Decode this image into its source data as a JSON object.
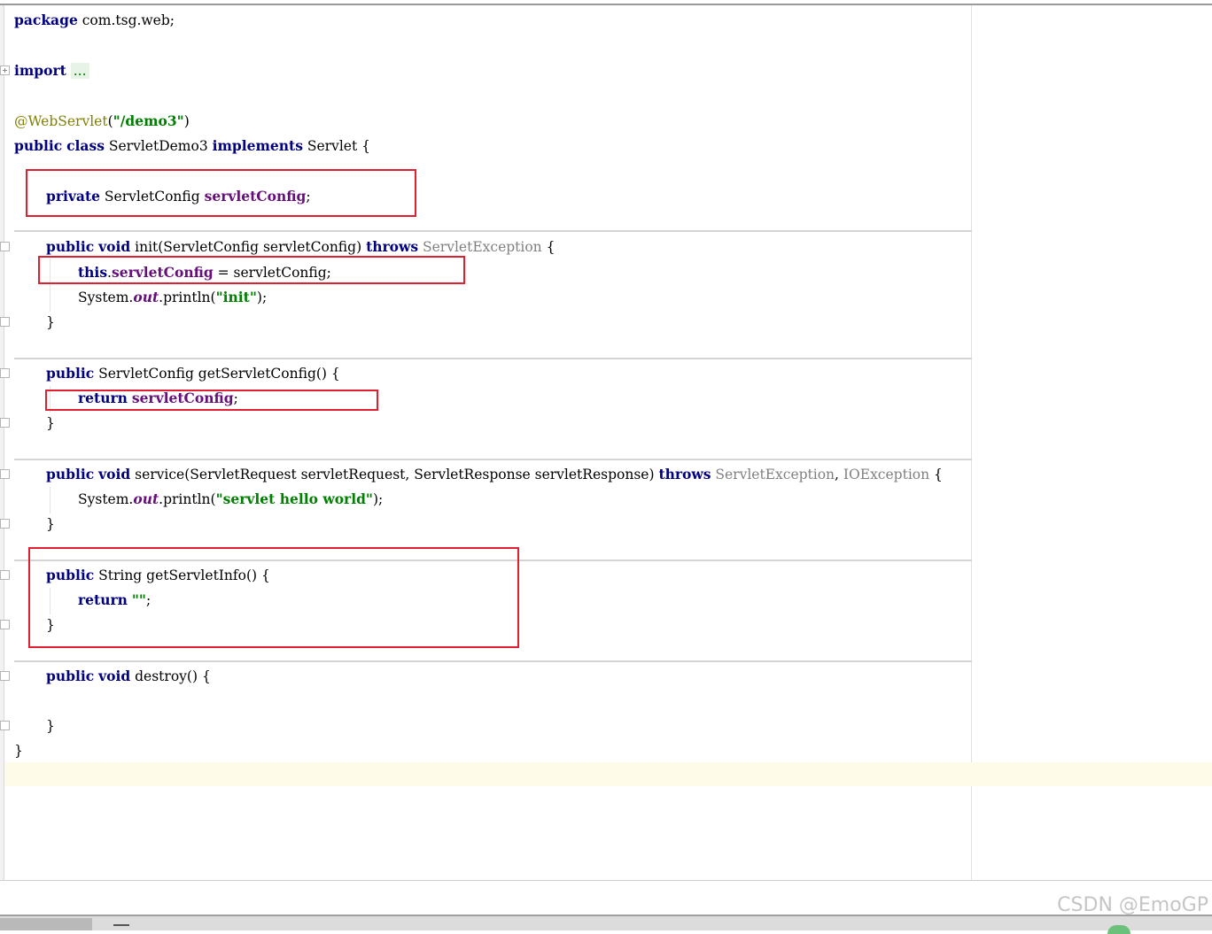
{
  "code": {
    "package_kw": "package",
    "package_name": "com.tsg.web;",
    "import_kw": "import",
    "import_folded": "...",
    "annotation": "@WebServlet",
    "annotation_open": "(",
    "annotation_value": "\"/demo3\"",
    "annotation_close": ")",
    "class_public": "public",
    "class_kw": "class",
    "class_name": "ServletDemo3",
    "implements_kw": "implements",
    "interface_name": "Servlet",
    "open_brace": "{",
    "close_brace": "}",
    "field_private": "private",
    "field_type": "ServletConfig",
    "field_name": "servletConfig",
    "semicolon": ";",
    "init_public": "public",
    "init_void": "void",
    "init_sig": "init(ServletConfig servletConfig)",
    "init_throws": "throws",
    "init_exception": "ServletException",
    "this_kw": "this",
    "dot": ".",
    "assign_field": "servletConfig",
    "assign_rest": " = servletConfig;",
    "sysout_prefix": "System.",
    "sysout_out": "out",
    "sysout_println": ".println(",
    "init_string": "\"init\"",
    "call_close": ");",
    "getcfg_public": "public",
    "getcfg_sig": "ServletConfig getServletConfig()",
    "return_kw": "return",
    "return_field": "servletConfig",
    "service_public": "public",
    "service_void": "void",
    "service_sig": "service(ServletRequest servletRequest, ServletResponse servletResponse)",
    "service_throws": "throws",
    "service_exc1": "ServletException",
    "comma": ",",
    "service_exc2": "IOException",
    "service_string": "\"servlet hello world\"",
    "info_public": "public",
    "info_sig": "String getServletInfo()",
    "info_return_string": "\"\"",
    "destroy_public": "public",
    "destroy_void": "void",
    "destroy_sig": "destroy()"
  },
  "watermark": "CSDN @EmoGP"
}
